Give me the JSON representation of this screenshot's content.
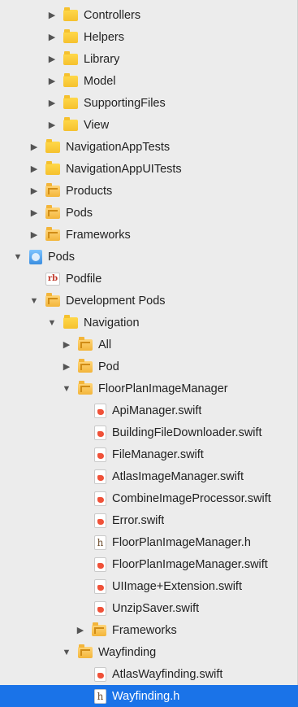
{
  "navigator": {
    "items": [
      {
        "label": "Controllers",
        "icon": "folder-yellow-icon",
        "expanded": false
      },
      {
        "label": "Helpers",
        "icon": "folder-yellow-icon",
        "expanded": false
      },
      {
        "label": "Library",
        "icon": "folder-yellow-icon",
        "expanded": false
      },
      {
        "label": "Model",
        "icon": "folder-yellow-icon",
        "expanded": false
      },
      {
        "label": "SupportingFiles",
        "icon": "folder-yellow-icon",
        "expanded": false
      },
      {
        "label": "View",
        "icon": "folder-yellow-icon",
        "expanded": false
      },
      {
        "label": "NavigationAppTests",
        "icon": "folder-yellow-icon",
        "expanded": false
      },
      {
        "label": "NavigationAppUITests",
        "icon": "folder-yellow-icon",
        "expanded": false
      },
      {
        "label": "Products",
        "icon": "folder-group-icon",
        "expanded": false
      },
      {
        "label": "Pods",
        "icon": "folder-group-icon",
        "expanded": false
      },
      {
        "label": "Frameworks",
        "icon": "folder-group-icon",
        "expanded": false
      },
      {
        "label": "Pods",
        "icon": "xcode-project-icon",
        "expanded": true
      },
      {
        "label": "Podfile",
        "icon": "ruby-file-icon"
      },
      {
        "label": "Development Pods",
        "icon": "folder-group-icon",
        "expanded": true
      },
      {
        "label": "Navigation",
        "icon": "folder-yellow-icon",
        "expanded": true
      },
      {
        "label": "All",
        "icon": "folder-group-icon",
        "expanded": false
      },
      {
        "label": "Pod",
        "icon": "folder-group-icon",
        "expanded": false
      },
      {
        "label": "FloorPlanImageManager",
        "icon": "folder-group-icon",
        "expanded": true
      },
      {
        "label": "ApiManager.swift",
        "icon": "swift-file-icon"
      },
      {
        "label": "BuildingFileDownloader.swift",
        "icon": "swift-file-icon"
      },
      {
        "label": "FileManager.swift",
        "icon": "swift-file-icon"
      },
      {
        "label": "AtlasImageManager.swift",
        "icon": "swift-file-icon"
      },
      {
        "label": "CombineImageProcessor.swift",
        "icon": "swift-file-icon"
      },
      {
        "label": "Error.swift",
        "icon": "swift-file-icon"
      },
      {
        "label": "FloorPlanImageManager.h",
        "icon": "header-file-icon"
      },
      {
        "label": "FloorPlanImageManager.swift",
        "icon": "swift-file-icon"
      },
      {
        "label": "UIImage+Extension.swift",
        "icon": "swift-file-icon"
      },
      {
        "label": "UnzipSaver.swift",
        "icon": "swift-file-icon"
      },
      {
        "label": "Frameworks",
        "icon": "folder-group-icon",
        "expanded": false
      },
      {
        "label": "Wayfinding",
        "icon": "folder-group-icon",
        "expanded": true
      },
      {
        "label": "AtlasWayfinding.swift",
        "icon": "swift-file-icon"
      },
      {
        "label": "Wayfinding.h",
        "icon": "header-file-icon",
        "selected": true
      }
    ]
  },
  "colors": {
    "background": "#ececec",
    "selection": "#1a73e8",
    "folder_yellow": "#f5c12e",
    "swift_orange": "#f05138"
  }
}
